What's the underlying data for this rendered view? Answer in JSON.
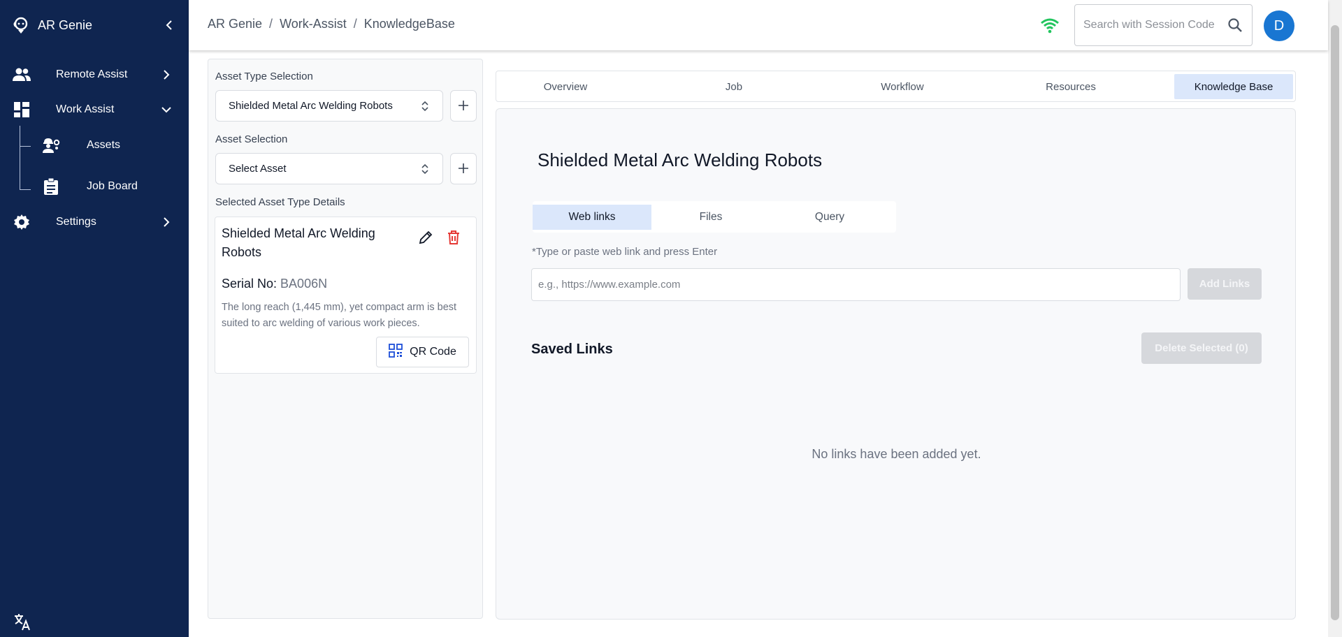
{
  "sidebar": {
    "brand": "AR Genie",
    "items": [
      {
        "label": "Remote Assist"
      },
      {
        "label": "Work Assist"
      },
      {
        "label": "Assets"
      },
      {
        "label": "Job Board"
      },
      {
        "label": "Settings"
      }
    ]
  },
  "header": {
    "breadcrumb": [
      "AR Genie",
      "Work-Assist",
      "KnowledgeBase"
    ],
    "search_placeholder": "Search with Session Code",
    "avatar_initial": "D"
  },
  "left_panel": {
    "asset_type_label": "Asset Type Selection",
    "asset_type_value": "Shielded Metal Arc Welding Robots",
    "asset_label": "Asset Selection",
    "asset_value": "Select Asset",
    "details_label": "Selected Asset Type Details",
    "details": {
      "name": "Shielded Metal Arc Welding Robots",
      "serial_label": "Serial No:",
      "serial_value": "BA006N",
      "description": "The long reach (1,445 mm), yet compact arm is best suited to arc welding of various work pieces.",
      "qr_label": "QR Code"
    }
  },
  "tabs": [
    "Overview",
    "Job",
    "Workflow",
    "Resources",
    "Knowledge Base"
  ],
  "knowledge_base": {
    "heading": "Shielded Metal Arc Welding Robots",
    "subtabs": [
      "Web links",
      "Files",
      "Query"
    ],
    "hint": "*Type or paste web link and press Enter",
    "input_placeholder": "e.g., https://www.example.com",
    "add_label": "Add Links",
    "saved_title": "Saved Links",
    "delete_label": "Delete Selected (0)",
    "empty_text": "No links have been added yet."
  },
  "colors": {
    "sidebar_bg": "#0f2550",
    "accent": "#1976d2",
    "active_tab_bg": "#dbe7fb",
    "delete_icon": "#e53935",
    "wifi": "#22c55e"
  }
}
